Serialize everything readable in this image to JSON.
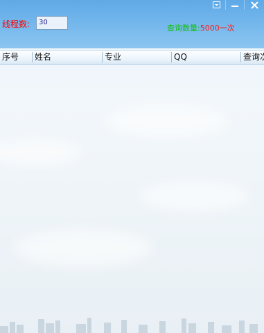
{
  "window": {
    "controls": {
      "menu_symbol": "▾",
      "minimize_symbol": "—",
      "close_symbol": "✕"
    }
  },
  "toolbar": {
    "thread_label": "线程数:",
    "thread_value": "30",
    "query_count_label": "查询数量:",
    "query_count_value": "5000一次"
  },
  "table": {
    "columns": [
      "序号",
      "姓名",
      "专业",
      "QQ",
      "查询次"
    ]
  },
  "icons": [
    "dropdown-menu-icon",
    "minimize-icon",
    "close-icon"
  ]
}
